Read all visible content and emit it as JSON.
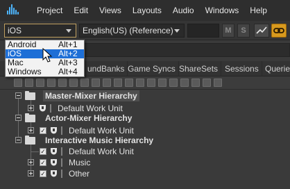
{
  "menubar": {
    "items": [
      "Project",
      "Edit",
      "Views",
      "Layouts",
      "Audio",
      "Windows",
      "Help"
    ]
  },
  "toolbar": {
    "platform_value": "iOS",
    "language_value": "English(US) (Reference)",
    "m_label": "M",
    "s_label": "S"
  },
  "tabs": [
    "undBanks",
    "Game Syncs",
    "ShareSets",
    "Sessions",
    "Queries"
  ],
  "platform_dropdown": {
    "options": [
      {
        "name": "Android",
        "shortcut": "Alt+1"
      },
      {
        "name": "iOS",
        "shortcut": "Alt+2"
      },
      {
        "name": "Mac",
        "shortcut": "Alt+3"
      },
      {
        "name": "Windows",
        "shortcut": "Alt+4"
      }
    ],
    "selected_index": 1
  },
  "tree": {
    "master_mixer": "Master-Mixer Hierarchy",
    "master_default": "Default Work Unit",
    "actor_mixer": "Actor-Mixer Hierarchy",
    "actor_default": "Default Work Unit",
    "interactive_music": "Interactive Music Hierarchy",
    "im_default": "Default Work Unit",
    "music": "Music",
    "other": "Other"
  },
  "colors": {
    "accent_orange": "#d89a1e",
    "selection_blue": "#1e6fd6",
    "logo_blue": "#4db6ff"
  },
  "icons": [
    "wwise-logo-icon",
    "chevron-down-icon",
    "chart-icon",
    "link-icon",
    "folder-icon",
    "work-unit-icon",
    "checkbox-icon",
    "mouse-cursor-icon"
  ]
}
